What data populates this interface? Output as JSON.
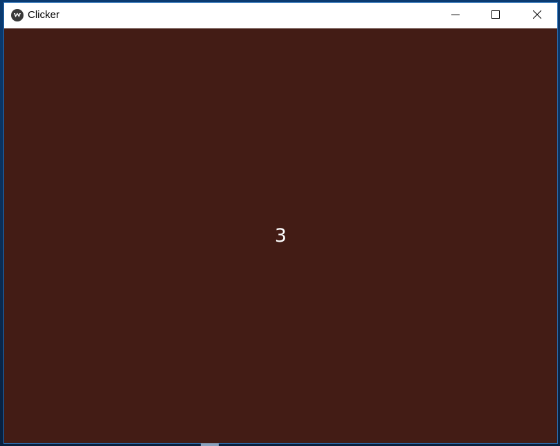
{
  "window": {
    "title": "Clicker",
    "app_icon": "kivy-logo-icon",
    "controls": {
      "minimize_icon": "minimize-icon",
      "maximize_icon": "maximize-icon",
      "close_icon": "close-icon"
    }
  },
  "content": {
    "counter_value": "3"
  },
  "colors": {
    "titlebar_bg": "#ffffff",
    "client_bg": "#431c15",
    "counter_text": "#ffffff",
    "desktop_bg": "#0b2d55"
  }
}
